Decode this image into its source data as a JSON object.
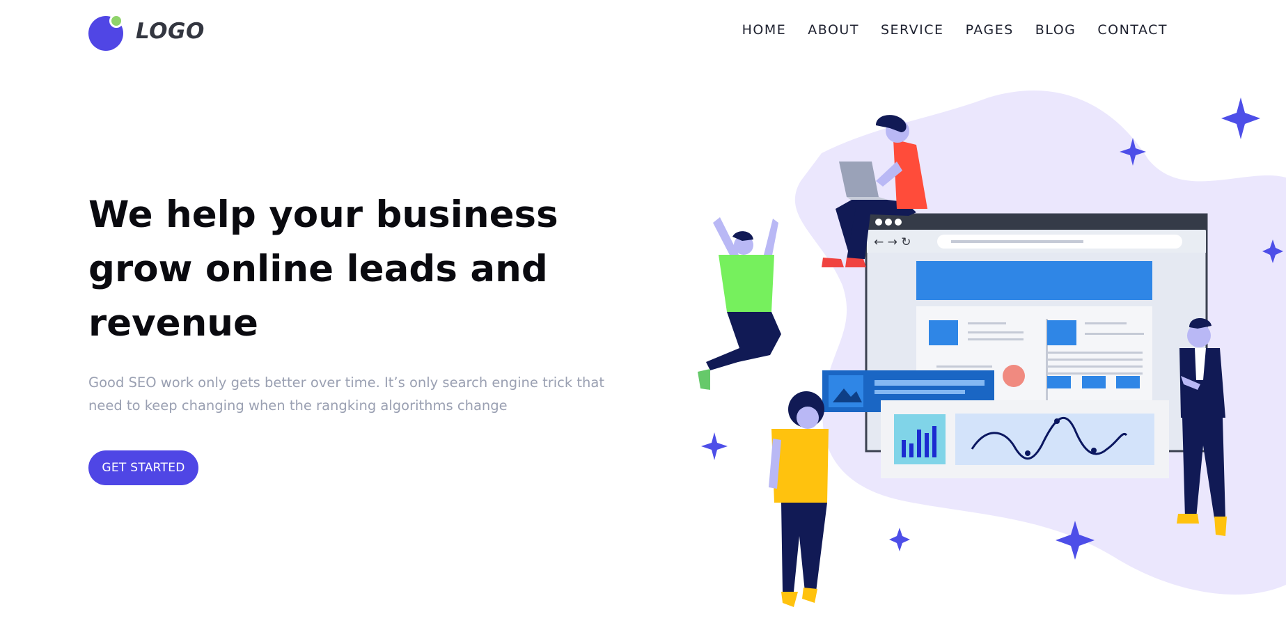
{
  "header": {
    "logo_text": "LOGO",
    "nav": [
      "HOME",
      "ABOUT",
      "SERVICE",
      "PAGES",
      "BLOG",
      "CONTACT"
    ]
  },
  "hero": {
    "title": "We help your business grow online leads and revenue",
    "description": "Good SEO work only gets better over time. It’s only search engine trick that need to keep changing when the rangking algorithms change",
    "cta_label": "GET STARTED"
  },
  "illustration": {
    "browser_nav_glyphs": "← → ↻",
    "chart_values": [
      5,
      4,
      8,
      7,
      9
    ]
  },
  "colors": {
    "accent": "#4f46e5",
    "logo_dot": "#8fd36a",
    "blob": "#ebe7fd",
    "browser_blue": "#2f86e6",
    "sparkle": "#4d4ee8"
  }
}
